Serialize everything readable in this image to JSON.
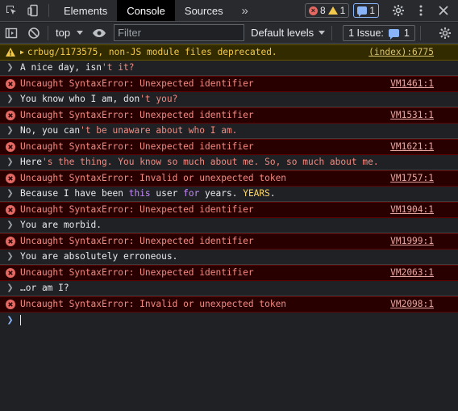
{
  "tabs": {
    "elements": "Elements",
    "console": "Console",
    "sources": "Sources",
    "more": "»"
  },
  "counts": {
    "errors": "8",
    "warnings": "1",
    "messages": "1"
  },
  "toolbar": {
    "context": "top",
    "filter_placeholder": "Filter",
    "levels": "Default levels",
    "issues_label": "1 Issue:",
    "issues_count": "1"
  },
  "warning": {
    "text": "crbug/1173575, non-JS module files deprecated.",
    "source": "(index):6775"
  },
  "messages": [
    {
      "kind": "input",
      "segments": [
        {
          "t": "A nice day, isn"
        },
        {
          "t": "'t it?",
          "c": "str"
        }
      ]
    },
    {
      "kind": "error",
      "text": "Uncaught SyntaxError: Unexpected identifier",
      "source": "VM1461:1"
    },
    {
      "kind": "input",
      "segments": [
        {
          "t": "You know who I am, don"
        },
        {
          "t": "'t you?",
          "c": "str"
        }
      ]
    },
    {
      "kind": "error",
      "text": "Uncaught SyntaxError: Unexpected identifier",
      "source": "VM1531:1"
    },
    {
      "kind": "input",
      "segments": [
        {
          "t": "No, you can"
        },
        {
          "t": "'t be unaware about who I am.",
          "c": "str"
        }
      ]
    },
    {
      "kind": "error",
      "text": "Uncaught SyntaxError: Unexpected identifier",
      "source": "VM1621:1"
    },
    {
      "kind": "input",
      "segments": [
        {
          "t": "Here"
        },
        {
          "t": "'s the thing. You know so much about me. So, so much about me.",
          "c": "str"
        }
      ]
    },
    {
      "kind": "error",
      "text": "Uncaught SyntaxError: Invalid or unexpected token",
      "source": "VM1757:1"
    },
    {
      "kind": "input",
      "segments": [
        {
          "t": "Because I have been "
        },
        {
          "t": "this",
          "c": "kw"
        },
        {
          "t": " user "
        },
        {
          "t": "for",
          "c": "kw"
        },
        {
          "t": " years. "
        },
        {
          "t": "YEARS",
          "c": "yel"
        },
        {
          "t": "."
        }
      ]
    },
    {
      "kind": "error",
      "text": "Uncaught SyntaxError: Unexpected identifier",
      "source": "VM1904:1"
    },
    {
      "kind": "input",
      "segments": [
        {
          "t": "You are morbid."
        }
      ]
    },
    {
      "kind": "error",
      "text": "Uncaught SyntaxError: Unexpected identifier",
      "source": "VM1999:1"
    },
    {
      "kind": "input",
      "segments": [
        {
          "t": "You are absolutely erroneous."
        }
      ]
    },
    {
      "kind": "error",
      "text": "Uncaught SyntaxError: Unexpected identifier",
      "source": "VM2063:1"
    },
    {
      "kind": "input",
      "segments": [
        {
          "t": "…or am I?"
        }
      ]
    },
    {
      "kind": "error",
      "text": "Uncaught SyntaxError: Invalid or unexpected token",
      "source": "VM2098:1"
    }
  ]
}
